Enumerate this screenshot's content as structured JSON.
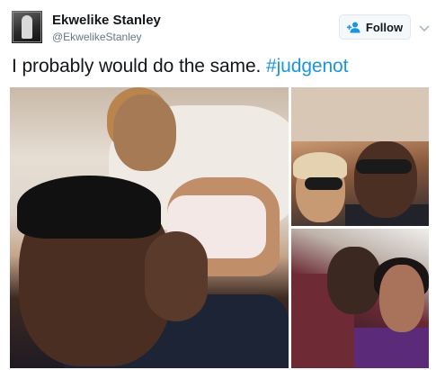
{
  "tweet": {
    "author": {
      "display_name": "Ekwelike Stanley",
      "handle": "@EkwelikeStanley"
    },
    "follow_button": {
      "label": "Follow",
      "icon": "add-user-icon"
    },
    "caret_icon": "chevron-down-icon",
    "text": "I probably would do the same. ",
    "hashtag": "#judgenot",
    "media": [
      {
        "name": "photo-main"
      },
      {
        "name": "photo-top-right"
      },
      {
        "name": "photo-bottom-right"
      }
    ]
  },
  "colors": {
    "text": "#14171a",
    "secondary": "#657786",
    "link": "#1b95e0",
    "button_border": "#e1e8ed",
    "button_bg": "#f5f8fa",
    "follow_icon": "#1b95e0"
  }
}
